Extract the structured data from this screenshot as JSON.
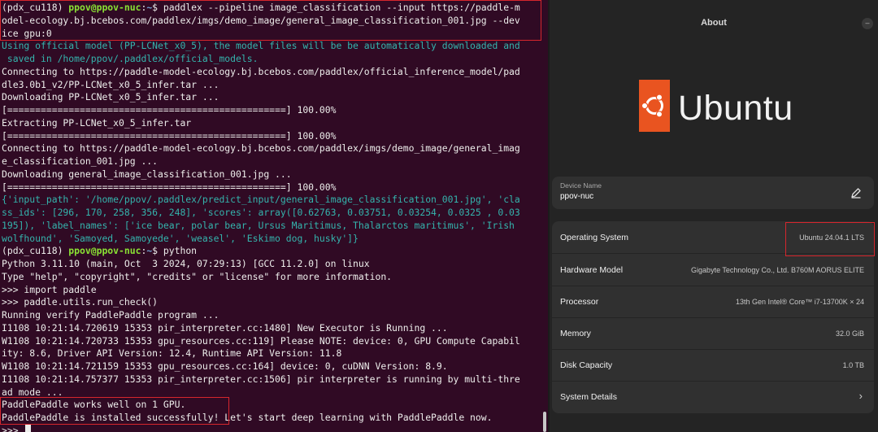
{
  "terminal": {
    "lines": [
      [
        {
          "t": "(pdx_cu118) ",
          "c": "white"
        },
        {
          "t": "ppov@ppov-nuc",
          "c": "green"
        },
        {
          "t": ":",
          "c": "white"
        },
        {
          "t": "~",
          "c": "blue"
        },
        {
          "t": "$ paddlex --pipeline image_classification --input https://paddle-m",
          "c": "white"
        }
      ],
      [
        {
          "t": "odel-ecology.bj.bcebos.com/paddlex/imgs/demo_image/general_image_classification_001.jpg --dev",
          "c": "white"
        }
      ],
      [
        {
          "t": "ice gpu:0",
          "c": "white"
        }
      ],
      [
        {
          "t": "Using official model (PP-LCNet_x0_5), the model files will be be automatically downloaded and",
          "c": "cyan"
        }
      ],
      [
        {
          "t": " saved in /home/ppov/.paddlex/official_models.",
          "c": "cyan"
        }
      ],
      [
        {
          "t": "Connecting to https://paddle-model-ecology.bj.bcebos.com/paddlex/official_inference_model/pad",
          "c": "white"
        }
      ],
      [
        {
          "t": "dle3.0b1_v2/PP-LCNet_x0_5_infer.tar ...",
          "c": "white"
        }
      ],
      [
        {
          "t": "Downloading PP-LCNet_x0_5_infer.tar ...",
          "c": "white"
        }
      ],
      [
        {
          "t": "[==================================================] 100.00%",
          "c": "white"
        }
      ],
      [
        {
          "t": "Extracting PP-LCNet_x0_5_infer.tar",
          "c": "white"
        }
      ],
      [
        {
          "t": "[==================================================] 100.00%",
          "c": "white"
        }
      ],
      [
        {
          "t": "Connecting to https://paddle-model-ecology.bj.bcebos.com/paddlex/imgs/demo_image/general_imag",
          "c": "white"
        }
      ],
      [
        {
          "t": "e_classification_001.jpg ...",
          "c": "white"
        }
      ],
      [
        {
          "t": "Downloading general_image_classification_001.jpg ...",
          "c": "white"
        }
      ],
      [
        {
          "t": "[==================================================] 100.00%",
          "c": "white"
        }
      ],
      [
        {
          "t": "{'input_path': '/home/ppov/.paddlex/predict_input/general_image_classification_001.jpg', 'cla",
          "c": "cyan"
        }
      ],
      [
        {
          "t": "ss_ids': [296, 170, 258, 356, 248], 'scores': array([0.62763, 0.03751, 0.03254, 0.0325 , 0.03",
          "c": "cyan"
        }
      ],
      [
        {
          "t": "195]), 'label_names': ['ice bear, polar bear, Ursus Maritimus, Thalarctos maritimus', 'Irish",
          "c": "cyan"
        }
      ],
      [
        {
          "t": "wolfhound', 'Samoyed, Samoyede', 'weasel', 'Eskimo dog, husky']}",
          "c": "cyan"
        }
      ],
      [
        {
          "t": "(pdx_cu118) ",
          "c": "white"
        },
        {
          "t": "ppov@ppov-nuc",
          "c": "green"
        },
        {
          "t": ":",
          "c": "white"
        },
        {
          "t": "~",
          "c": "blue"
        },
        {
          "t": "$ python",
          "c": "white"
        }
      ],
      [
        {
          "t": "Python 3.11.10 (main, Oct  3 2024, 07:29:13) [GCC 11.2.0] on linux",
          "c": "white"
        }
      ],
      [
        {
          "t": "Type \"help\", \"copyright\", \"credits\" or \"license\" for more information.",
          "c": "white"
        }
      ],
      [
        {
          "t": ">>> import paddle",
          "c": "white"
        }
      ],
      [
        {
          "t": ">>> paddle.utils.run_check()",
          "c": "white"
        }
      ],
      [
        {
          "t": "Running verify PaddlePaddle program ...",
          "c": "white"
        }
      ],
      [
        {
          "t": "I1108 10:21:14.720619 15353 pir_interpreter.cc:1480] New Executor is Running ...",
          "c": "white"
        }
      ],
      [
        {
          "t": "W1108 10:21:14.720733 15353 gpu_resources.cc:119] Please NOTE: device: 0, GPU Compute Capabil",
          "c": "white"
        }
      ],
      [
        {
          "t": "ity: 8.6, Driver API Version: 12.4, Runtime API Version: 11.8",
          "c": "white"
        }
      ],
      [
        {
          "t": "W1108 10:21:14.721159 15353 gpu_resources.cc:164] device: 0, cuDNN Version: 8.9.",
          "c": "white"
        }
      ],
      [
        {
          "t": "I1108 10:21:14.757377 15353 pir_interpreter.cc:1506] pir interpreter is running by multi-thre",
          "c": "white"
        }
      ],
      [
        {
          "t": "ad mode ...",
          "c": "white"
        }
      ],
      [
        {
          "t": "PaddlePaddle works well on 1 GPU.",
          "c": "white"
        }
      ],
      [
        {
          "t": "PaddlePaddle is installed successfully! Let's start deep learning with PaddlePaddle now.",
          "c": "white"
        }
      ],
      [
        {
          "t": ">>> ",
          "c": "white"
        }
      ]
    ]
  },
  "settings": {
    "title": "About",
    "logo_text": "Ubuntu",
    "device_name_label": "Device Name",
    "device_name_value": "ppov-nuc",
    "rows": [
      {
        "label": "Operating System",
        "value": "Ubuntu 24.04.1 LTS"
      },
      {
        "label": "Hardware Model",
        "value": "Gigabyte Technology Co., Ltd. B760M AORUS ELITE"
      },
      {
        "label": "Processor",
        "value": "13th Gen Intel® Core™ i7-13700K × 24"
      },
      {
        "label": "Memory",
        "value": "32.0 GiB"
      },
      {
        "label": "Disk Capacity",
        "value": "1.0 TB"
      },
      {
        "label": "System Details",
        "value": ""
      }
    ],
    "colors": {
      "accent": "#e95420",
      "highlight_box": "#d6262d",
      "terminal_bg": "#300a24"
    },
    "icons": {
      "edit": "pencil-icon",
      "chevron": "chevron-right-icon",
      "logo": "ubuntu-circle-of-friends-icon"
    }
  }
}
